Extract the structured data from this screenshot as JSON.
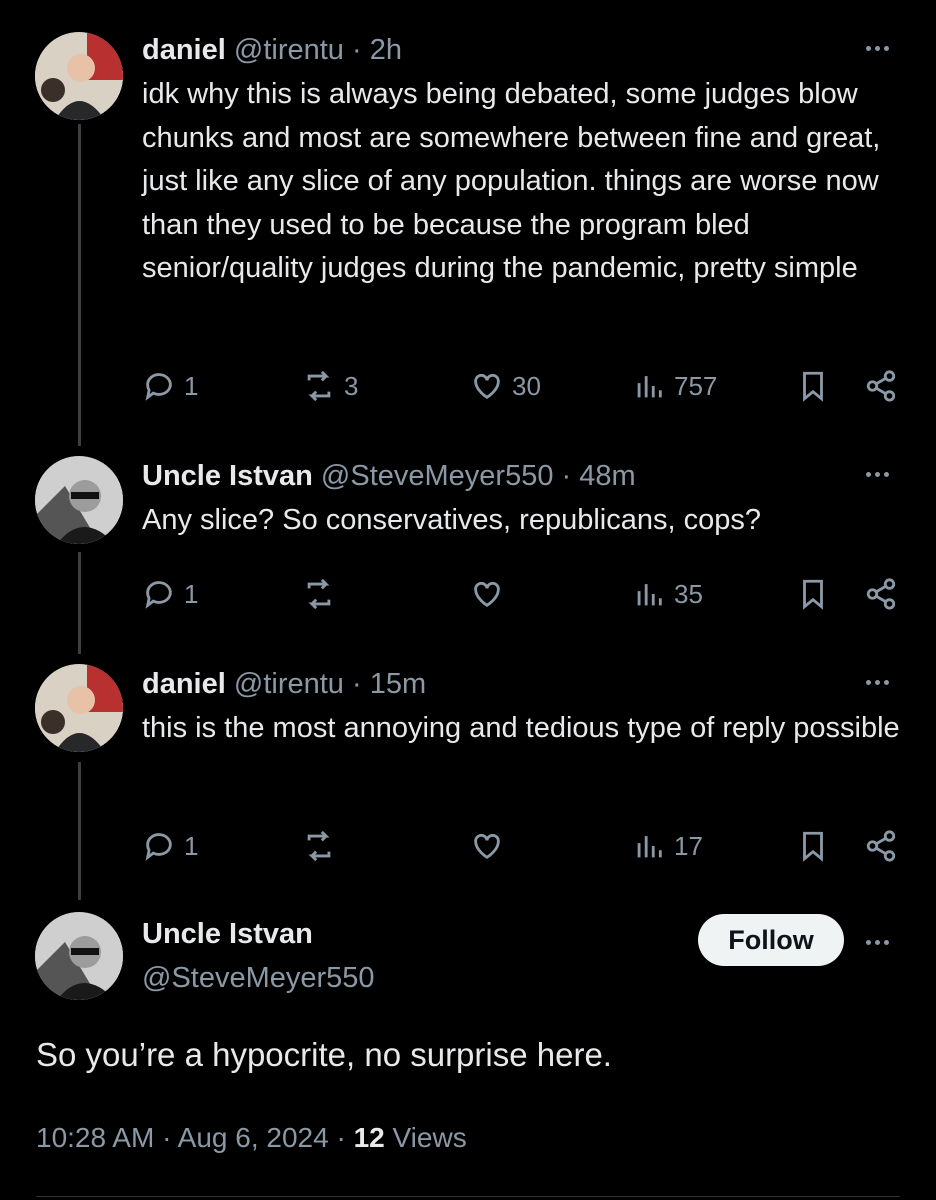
{
  "posts": [
    {
      "name": "daniel",
      "handle": "@tirentu",
      "sep": "·",
      "time": "2h",
      "text": "idk why this is always being debated, some judges blow chunks and most are somewhere between fine and great, just like any slice of any population. things are worse now than they used to be because the program bled senior/quality judges during the pandemic, pretty simple",
      "replies": "1",
      "reposts": "3",
      "likes": "30",
      "views": "757"
    },
    {
      "name": "Uncle Istvan",
      "handle": "@SteveMeyer550",
      "sep": "·",
      "time": "48m",
      "text": "Any slice? So conservatives, republicans, cops?",
      "replies": "1",
      "reposts": "",
      "likes": "",
      "views": "35"
    },
    {
      "name": "daniel",
      "handle": "@tirentu",
      "sep": "·",
      "time": "15m",
      "text": "this is the most annoying and tedious type of reply possible",
      "replies": "1",
      "reposts": "",
      "likes": "",
      "views": "17"
    }
  ],
  "main": {
    "name": "Uncle Istvan",
    "handle": "@SteveMeyer550",
    "follow_label": "Follow",
    "text": "So you’re a hypocrite, no surprise here.",
    "time": "10:28 AM",
    "sep1": "·",
    "date": "Aug 6, 2024",
    "sep2": "·",
    "views_count": "12",
    "views_label": "Views"
  },
  "colors": {
    "background": "#000000",
    "text": "#e7e9ea",
    "muted": "#8b98a5",
    "follow_bg": "#eff3f4"
  },
  "icons": [
    "reply-icon",
    "repost-icon",
    "like-icon",
    "views-icon",
    "bookmark-icon",
    "share-icon",
    "more-icon"
  ]
}
